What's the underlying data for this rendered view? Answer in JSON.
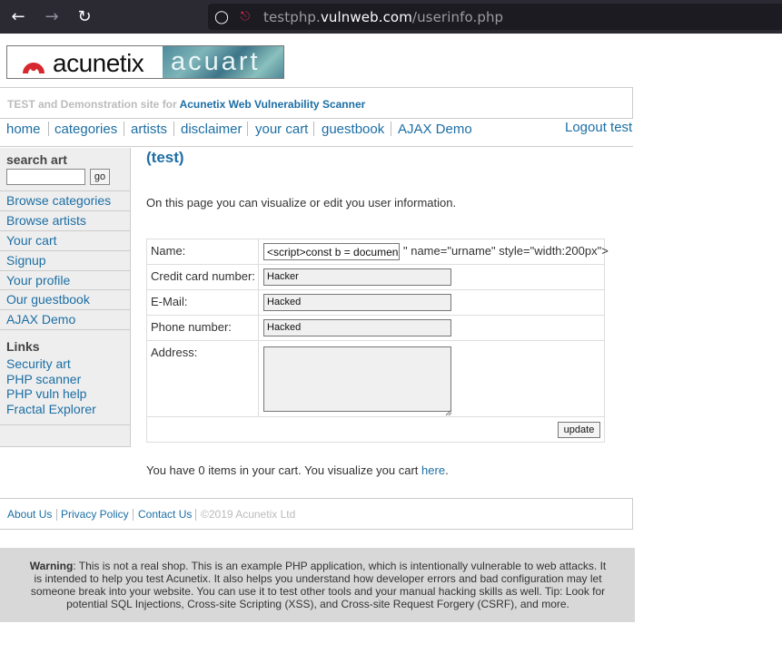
{
  "browser": {
    "url_prefix": "testphp.",
    "url_host": "vulnweb.com",
    "url_path": "/userinfo.php",
    "back_icon": "arrow-left-icon",
    "forward_icon": "arrow-right-icon",
    "reload_icon": "reload-icon",
    "shield_icon": "shield-icon",
    "lock_icon": "insecure-lock-icon"
  },
  "logo": {
    "acunetix": "acunetix",
    "acuart": "acuart",
    "brand_color": "#d6282d"
  },
  "tagline": {
    "prefix": "TEST and Demonstration site for ",
    "link": "Acunetix Web Vulnerability Scanner"
  },
  "globalnav": {
    "items": [
      "home",
      "categories",
      "artists",
      "disclaimer",
      "your cart",
      "guestbook",
      "AJAX Demo"
    ],
    "logout": "Logout test"
  },
  "sidebar": {
    "search_label": "search art",
    "search_value": "",
    "go_label": "go",
    "links": [
      "Browse categories",
      "Browse artists",
      "Your cart",
      "Signup",
      "Your profile",
      "Our guestbook",
      "AJAX Demo"
    ],
    "links_heading": "Links",
    "external": [
      "Security art",
      "PHP scanner",
      "PHP vuln help",
      "Fractal Explorer"
    ]
  },
  "main": {
    "heading": "(test)",
    "intro": "On this page you can visualize or edit you user information."
  },
  "form": {
    "name_label": "Name:",
    "name_value": "<script>const b = documen",
    "name_overflow": "\" name=\"urname\" style=\"width:200px\">",
    "cc_label": "Credit card number:",
    "cc_value": "Hacker",
    "email_label": "E-Mail:",
    "email_value": "Hacked",
    "phone_label": "Phone number:",
    "phone_value": "Hacked",
    "address_label": "Address:",
    "address_value": "",
    "update_label": "update"
  },
  "cart": {
    "message": "You have 0 items in your cart. You visualize you cart ",
    "link": "here",
    "suffix": "."
  },
  "footer": {
    "about": "About Us",
    "privacy": "Privacy Policy",
    "contact": "Contact Us",
    "copyright": "©2019 Acunetix Ltd"
  },
  "warning": {
    "bold": "Warning",
    "text": ": This is not a real shop. This is an example PHP application, which is intentionally vulnerable to web attacks. It is intended to help you test Acunetix. It also helps you understand how developer errors and bad configuration may let someone break into your website. You can use it to test other tools and your manual hacking skills as well. Tip: Look for potential SQL Injections, Cross-site Scripting (XSS), and Cross-site Request Forgery (CSRF), and more."
  }
}
